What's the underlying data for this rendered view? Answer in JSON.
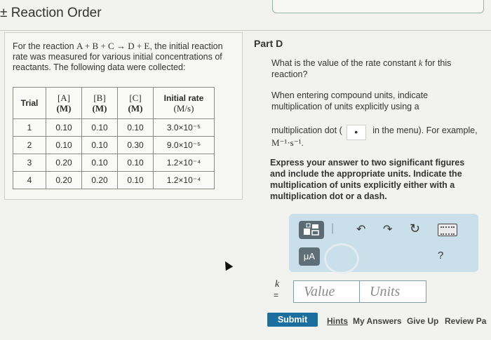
{
  "header": {
    "title": "± Reaction Order"
  },
  "problem": {
    "intro_pre": "For the reaction ",
    "equation": "A + B + C → D + E",
    "intro_post": ", the initial reaction rate was measured for various initial concentrations of reactants. The following data were collected:",
    "table": {
      "headers": [
        {
          "top": "Trial",
          "unit": ""
        },
        {
          "top": "[A]",
          "unit": "(M)"
        },
        {
          "top": "[B]",
          "unit": "(M)"
        },
        {
          "top": "[C]",
          "unit": "(M)"
        },
        {
          "top": "Initial rate",
          "unit": "(M/s)"
        }
      ],
      "rows": [
        [
          "1",
          "0.10",
          "0.10",
          "0.10",
          "3.0×10⁻⁵"
        ],
        [
          "2",
          "0.10",
          "0.10",
          "0.30",
          "9.0×10⁻⁵"
        ],
        [
          "3",
          "0.20",
          "0.10",
          "0.10",
          "1.2×10⁻⁴"
        ],
        [
          "4",
          "0.20",
          "0.20",
          "0.10",
          "1.2×10⁻⁴"
        ]
      ]
    }
  },
  "part": {
    "title": "Part D",
    "question_pre": "What is the value of the rate constant ",
    "question_var": "k",
    "question_post": " for this reaction?",
    "units_note_1": "When entering compound units, indicate multiplication of units explicitly using a",
    "units_note_2_pre": "multiplication dot (",
    "dot_glyph": "•",
    "units_note_2_post": " in the menu). For example,",
    "example_units": "M⁻¹·s⁻¹.",
    "instruction": "Express your answer to two significant figures and include the appropriate units. Indicate the multiplication of units explicitly either with a multiplication dot or a dash."
  },
  "toolbar": {
    "templates_icon": "templates-icon",
    "undo_icon": "↶",
    "redo_icon": "↷",
    "reset_icon": "↻",
    "keyboard_icon": "keyboard-icon",
    "units_button": "μA",
    "help_icon": "?"
  },
  "answer": {
    "variable": "k",
    "equals": "=",
    "value_placeholder": "Value",
    "units_placeholder": "Units"
  },
  "actions": {
    "submit": "Submit",
    "hints": "Hints",
    "my_answers": "My Answers",
    "give_up": "Give Up",
    "review_part": "Review Pa"
  }
}
